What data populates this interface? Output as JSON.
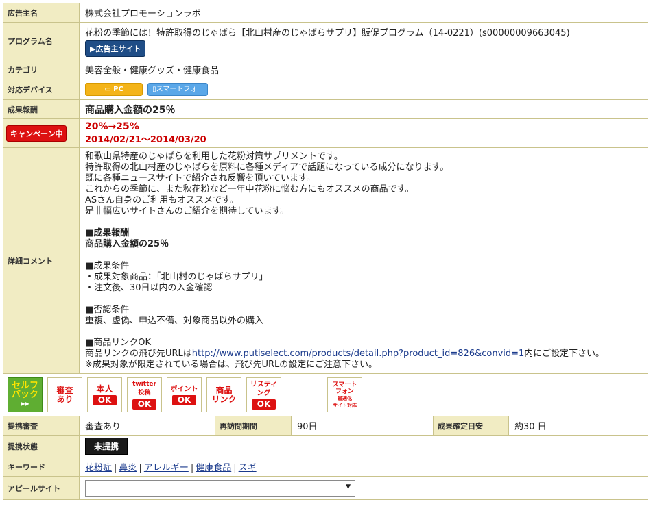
{
  "advertiser": {
    "label": "広告主名",
    "value": "株式会社プロモーションラボ"
  },
  "program": {
    "label": "プログラム名",
    "value": "花粉の季節には！特許取得のじゃばら【北山村産のじゃばらサプリ】販促プログラム（14-0221）(s00000009663045)",
    "site_button": "▶広告主サイト"
  },
  "category": {
    "label": "カテゴリ",
    "value": "美容全般・健康グッズ・健康食品"
  },
  "devices": {
    "label": "対応デバイス",
    "pc": "PC",
    "smartphone": "スマートフォン"
  },
  "reward": {
    "label": "成果報酬",
    "value": "商品購入金額の25％"
  },
  "campaign": {
    "label": "キャンペーン中",
    "rate": "20%→25%",
    "period": "2014/02/21〜2014/03/20"
  },
  "comment": {
    "label": "詳細コメント",
    "lines": [
      "和歌山県特産のじゃばらを利用した花粉対策サプリメントです。",
      "特許取得の北山村産のじゃばらを原料に各種メディアで話題になっている成分になります。",
      "既に各種ニュースサイトで紹介され反響を頂いています。",
      "これからの季節に、また秋花粉など一年中花粉に悩む方にもオススメの商品です。",
      "ASさん自身のご利用もオススメです。",
      "是非幅広いサイトさんのご紹介を期待しています。"
    ],
    "reward_heading": "■成果報酬",
    "reward_value": "商品購入金額の25％",
    "cond_heading": "■成果条件",
    "cond_lines": [
      "・成果対象商品：「北山村のじゃばらサプリ」",
      "・注文後、30日以内の入金確認"
    ],
    "reject_heading": "■否認条件",
    "reject_line": "重複、虚偽、申込不備、対象商品以外の購入",
    "link_heading": "■商品リンクOK",
    "link_prefix": "商品リンクの飛び先URLは",
    "link_url": "http://www.putiselect.com/products/detail.php?product_id=826&convid=1",
    "link_suffix": "内にご設定下さい。",
    "link_note": "※成果対象が限定されている場合は、飛び先URLの設定にご注意下さい。"
  },
  "badges": {
    "self": {
      "line1": "セルフ",
      "line2": "バック",
      "arrows": "▶▶"
    },
    "review": {
      "line1": "審査",
      "line2": "あり"
    },
    "person": {
      "line1": "本人",
      "ok": "OK"
    },
    "twitter": {
      "line1": "twitter",
      "line2": "投稿",
      "ok": "OK"
    },
    "point": {
      "line1": "ポイント",
      "ok": "OK"
    },
    "product": {
      "line1": "商品",
      "line2": "リンク"
    },
    "listing": {
      "line1": "リスティ",
      "line2": "ング",
      "ok": "OK"
    },
    "smart": {
      "line1": "スマート",
      "line2": "フォン",
      "line3": "最適化",
      "line4": "サイト対応"
    }
  },
  "stats": {
    "review_label": "提携審査",
    "review_value": "審査あり",
    "revisit_label": "再訪問期間",
    "revisit_value": "90日",
    "confirm_label": "成果確定目安",
    "confirm_value": "約30 日"
  },
  "status": {
    "label": "提携状態",
    "button": "未提携"
  },
  "keywords": {
    "label": "キーワード",
    "items": [
      "花粉症",
      "鼻炎",
      "アレルギー",
      "健康食品",
      "スギ"
    ],
    "sep": "|"
  },
  "appeal": {
    "label": "アピールサイト",
    "selected": "",
    "arrow": "▼"
  },
  "colors": {
    "label_bg": "#f1ecc3",
    "border": "#c9c38c",
    "campaign_red": "#cc0000",
    "badge_red": "#dd1111"
  }
}
